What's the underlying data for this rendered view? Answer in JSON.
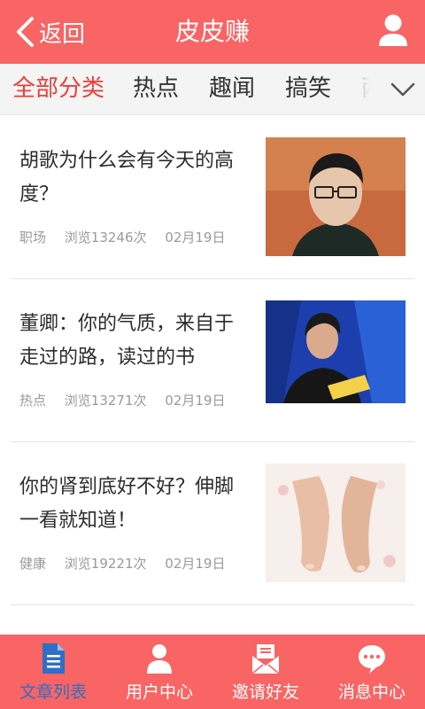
{
  "header": {
    "back_label": "返回",
    "title": "皮皮赚"
  },
  "tabs": [
    {
      "label": "全部分类",
      "active": true
    },
    {
      "label": "热点",
      "active": false
    },
    {
      "label": "趣闻",
      "active": false
    },
    {
      "label": "搞笑",
      "active": false
    },
    {
      "label": "两",
      "active": false
    }
  ],
  "articles": [
    {
      "title": "胡歌为什么会有今天的高度？",
      "category": "职场",
      "views": "浏览13246次",
      "date": "02月19日"
    },
    {
      "title": "董卿：你的气质，来自于走过的路，读过的书",
      "category": "热点",
      "views": "浏览13271次",
      "date": "02月19日"
    },
    {
      "title": "你的肾到底好不好？伸脚一看就知道！",
      "category": "健康",
      "views": "浏览19221次",
      "date": "02月19日"
    }
  ],
  "tabbar": [
    {
      "label": "文章列表",
      "icon": "document-icon",
      "active": true
    },
    {
      "label": "用户中心",
      "icon": "user-icon",
      "active": false
    },
    {
      "label": "邀请好友",
      "icon": "invite-icon",
      "active": false
    },
    {
      "label": "消息中心",
      "icon": "message-icon",
      "active": false
    }
  ],
  "colors": {
    "brand": "#f96464",
    "active_tab_text": "#e8403a",
    "active_tabbar_text": "#2f6fc4"
  }
}
